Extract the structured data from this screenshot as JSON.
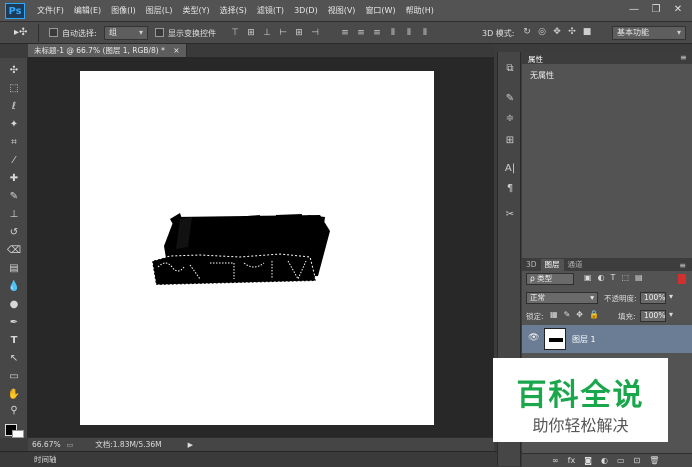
{
  "app": {
    "logo": "Ps"
  },
  "menu": [
    "文件(F)",
    "编辑(E)",
    "图像(I)",
    "图层(L)",
    "类型(Y)",
    "选择(S)",
    "滤镜(T)",
    "3D(D)",
    "视图(V)",
    "窗口(W)",
    "帮助(H)"
  ],
  "window_controls": {
    "minimize": "—",
    "restore": "❐",
    "close": "✕"
  },
  "options_bar": {
    "auto_select_label": "自动选择:",
    "auto_select_value": "组",
    "show_transform_label": "显示变换控件",
    "mode_3d_label": "3D 模式:",
    "workspace_value": "基本功能"
  },
  "document": {
    "tab_title": "未标题-1 @ 66.7% (图层 1, RGB/8) *",
    "tab_close": "×"
  },
  "status": {
    "zoom": "66.67%",
    "doc_info": "文档:1.83M/5.36M"
  },
  "timeline": {
    "label": "时间轴"
  },
  "properties_panel": {
    "tab": "属性",
    "content": "无属性"
  },
  "layers_panel": {
    "tabs": [
      "3D",
      "图层",
      "通道"
    ],
    "filter_label": "ρ 类型",
    "blend_mode": "正常",
    "opacity_label": "不透明度:",
    "opacity_value": "100%",
    "lock_label": "锁定:",
    "fill_label": "填充:",
    "fill_value": "100%",
    "layer_name": "图层 1"
  },
  "watermark": {
    "title": "百科全说",
    "subtitle": "助你轻松解决",
    "title_color": "#1aa64b"
  }
}
